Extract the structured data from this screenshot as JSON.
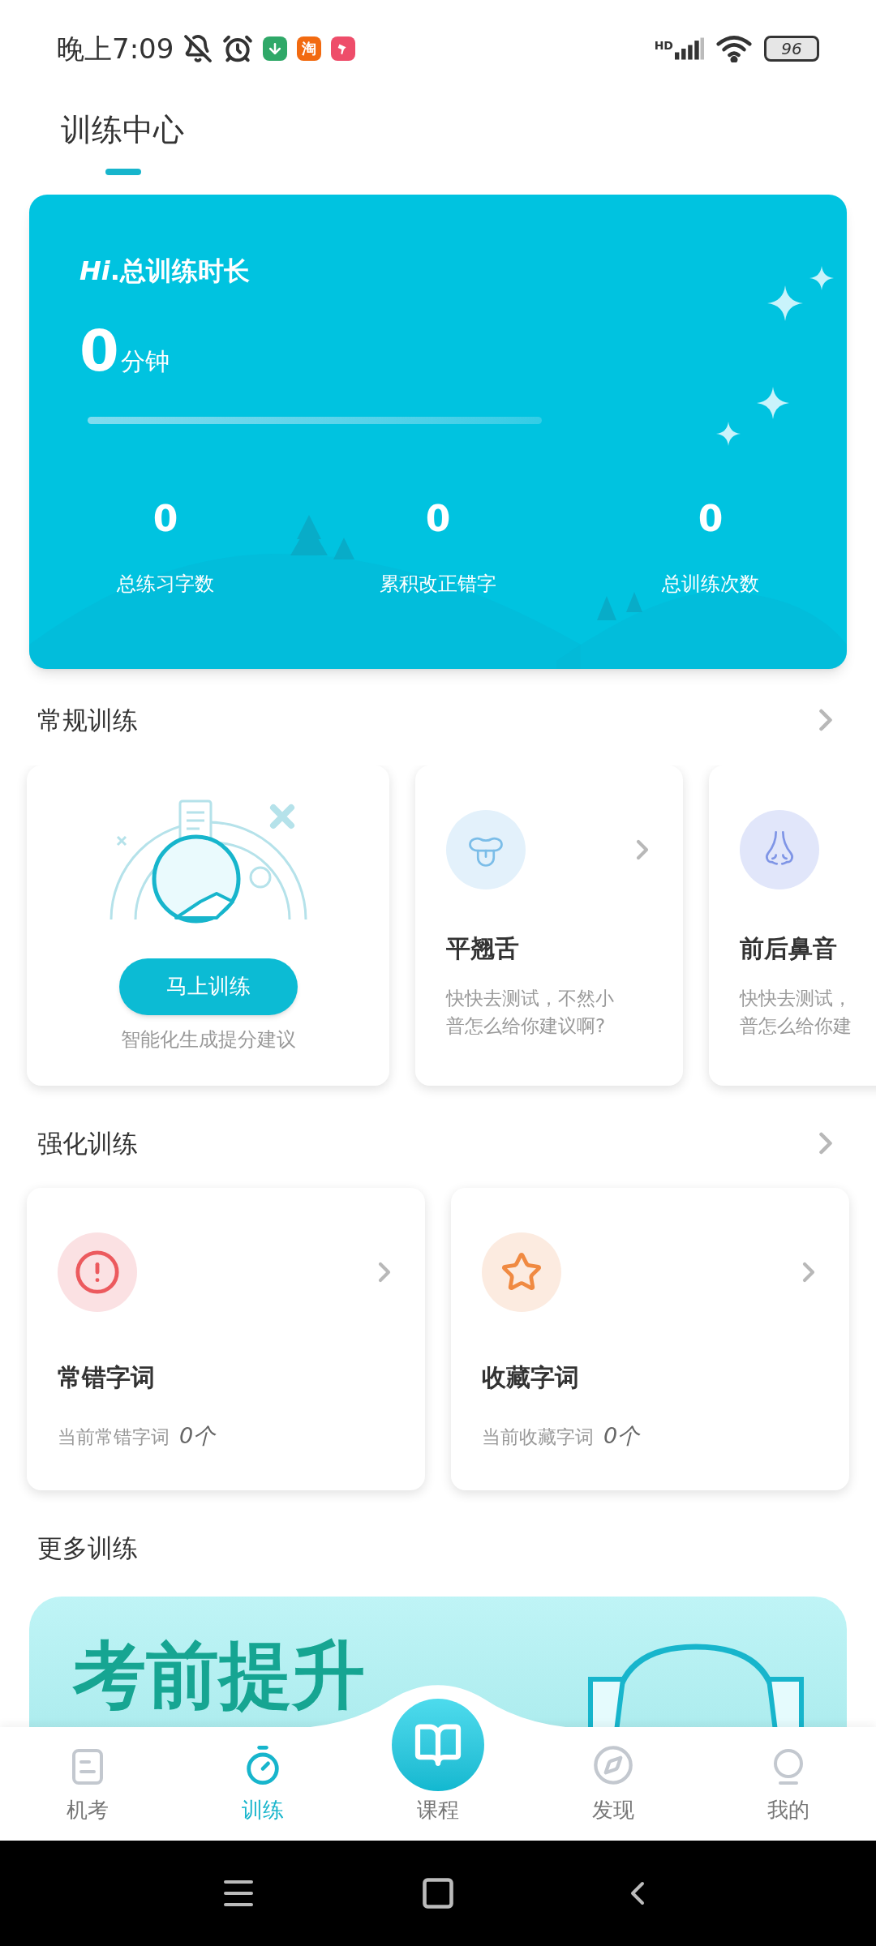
{
  "status_bar": {
    "time": "晚上7:09",
    "notification_icons": [
      {
        "kind": "bell-off"
      },
      {
        "kind": "alarm"
      },
      {
        "kind": "download"
      },
      {
        "kind": "shop",
        "label": "淘"
      },
      {
        "kind": "brush"
      }
    ],
    "network": "HD",
    "battery": "96"
  },
  "header": {
    "title": "训练中心"
  },
  "summary": {
    "greeting": "*Hi*.总训练时长",
    "duration_value": "0",
    "duration_unit": "分钟",
    "stats": [
      {
        "value": "0",
        "label": "总练习字数"
      },
      {
        "value": "0",
        "label": "累积改正错字"
      },
      {
        "value": "0",
        "label": "总训练次数"
      }
    ]
  },
  "regular": {
    "title": "常规训练",
    "cards": [
      {
        "kind": "featured",
        "button": "马上训练",
        "caption": "智能化生成提分建议"
      },
      {
        "kind": "tongue",
        "title": "平翘舌",
        "lines": [
          "快快去测试，不然小",
          "普怎么给你建议啊?"
        ],
        "arrow": true
      },
      {
        "kind": "nose",
        "title": "前后鼻音",
        "lines": [
          "快快去测试，",
          "普怎么给你建"
        ],
        "arrow": false
      }
    ]
  },
  "intensive": {
    "title": "强化训练",
    "cards": [
      {
        "kind": "mistakes",
        "title": "常错字词",
        "subtitle": "当前常错字词",
        "count": "0个"
      },
      {
        "kind": "favorites",
        "title": "收藏字词",
        "subtitle": "当前收藏字词",
        "count": "0个"
      }
    ]
  },
  "more": {
    "title": "更多训练",
    "banner": {
      "title": "考前提升"
    }
  },
  "nav": [
    {
      "kind": "exam",
      "label": "机考",
      "selected": false
    },
    {
      "kind": "training",
      "label": "训练",
      "selected": true
    },
    {
      "kind": "course",
      "label": "课程",
      "selected": false
    },
    {
      "kind": "discover",
      "label": "发现",
      "selected": false
    },
    {
      "kind": "profile",
      "label": "我的",
      "selected": false
    }
  ]
}
